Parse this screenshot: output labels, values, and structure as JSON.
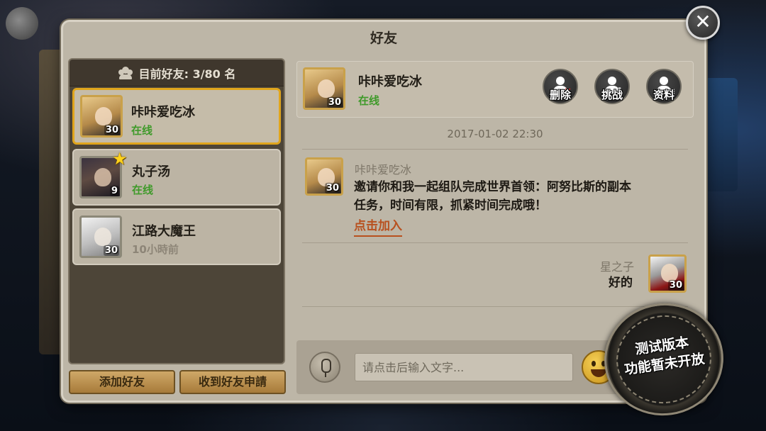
{
  "panel": {
    "title": "好友"
  },
  "close": {
    "label": "✕"
  },
  "friends_header": {
    "label": "目前好友: 3/80 名"
  },
  "friends": [
    {
      "name": "咔咔爱吃冰",
      "status": "在线",
      "level": "30",
      "avatar": "blonde-girl"
    },
    {
      "name": "丸子汤",
      "status": "在线",
      "level": "9",
      "avatar": "dark-hair-boy",
      "starred": true
    },
    {
      "name": "江路大魔王",
      "status": "10小時前",
      "level": "30",
      "avatar": "white-hair"
    }
  ],
  "star_glyph": "★",
  "left_buttons": {
    "add": "添加好友",
    "requests": "收到好友申請"
  },
  "contact": {
    "name": "咔咔爱吃冰",
    "status": "在线",
    "level": "30",
    "actions": [
      {
        "label": "删除",
        "icon": "user-delete-icon",
        "mark": "✕",
        "mark_color": "#e02020"
      },
      {
        "label": "挑战",
        "icon": "user-challenge-icon",
        "mark": "⬇",
        "mark_color": "#ffffff"
      },
      {
        "label": "资料",
        "icon": "user-profile-icon",
        "mark": "≡",
        "mark_color": "#ffffff"
      }
    ]
  },
  "chat": {
    "timestamp": "2017-01-02  22:30",
    "incoming": {
      "sender": "咔咔爱吃冰",
      "level": "30",
      "line1": "邀请你和我一起组队完成世界首领：阿努比斯的副本",
      "line2": "任务，时间有限，抓紧时间完成哦！",
      "link": "点击加入"
    },
    "outgoing": {
      "sender": "星之子",
      "text": "好的",
      "level": "30"
    }
  },
  "input": {
    "placeholder": "请点击后输入文字..."
  },
  "badge": {
    "line1": "测试版本",
    "line2": "功能暂未开放"
  },
  "colors": {
    "online": "#3f9a2a",
    "selected_border": "#e0a51c",
    "link": "#b8501e"
  }
}
